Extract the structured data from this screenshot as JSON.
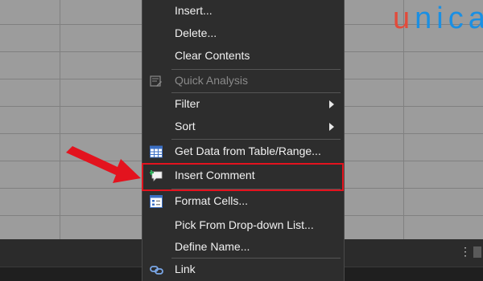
{
  "logo": {
    "first_letter": "u",
    "rest": "nica"
  },
  "menu": {
    "items": [
      {
        "label": "Insert...",
        "disabled": false,
        "submenu": false,
        "icon": ""
      },
      {
        "label": "Delete...",
        "disabled": false,
        "submenu": false,
        "icon": ""
      },
      {
        "label": "Clear Contents",
        "disabled": false,
        "submenu": false,
        "icon": ""
      },
      {
        "label": "Quick Analysis",
        "disabled": true,
        "submenu": false,
        "icon": "quick-analysis-icon"
      },
      {
        "label": "Filter",
        "disabled": false,
        "submenu": true,
        "icon": ""
      },
      {
        "label": "Sort",
        "disabled": false,
        "submenu": true,
        "icon": ""
      },
      {
        "label": "Get Data from Table/Range...",
        "disabled": false,
        "submenu": false,
        "icon": "table-icon"
      },
      {
        "label": "Insert Comment",
        "disabled": false,
        "submenu": false,
        "icon": "comment-icon"
      },
      {
        "label": "Format Cells...",
        "disabled": false,
        "submenu": false,
        "icon": "format-cells-icon"
      },
      {
        "label": "Pick From Drop-down List...",
        "disabled": false,
        "submenu": false,
        "icon": ""
      },
      {
        "label": "Define Name...",
        "disabled": false,
        "submenu": false,
        "icon": ""
      },
      {
        "label": "Link",
        "disabled": false,
        "submenu": false,
        "icon": "link-icon"
      }
    ]
  },
  "colors": {
    "accent_red": "#e3131e",
    "logo_blue": "#1a8fe3",
    "logo_red": "#e24b3b"
  }
}
